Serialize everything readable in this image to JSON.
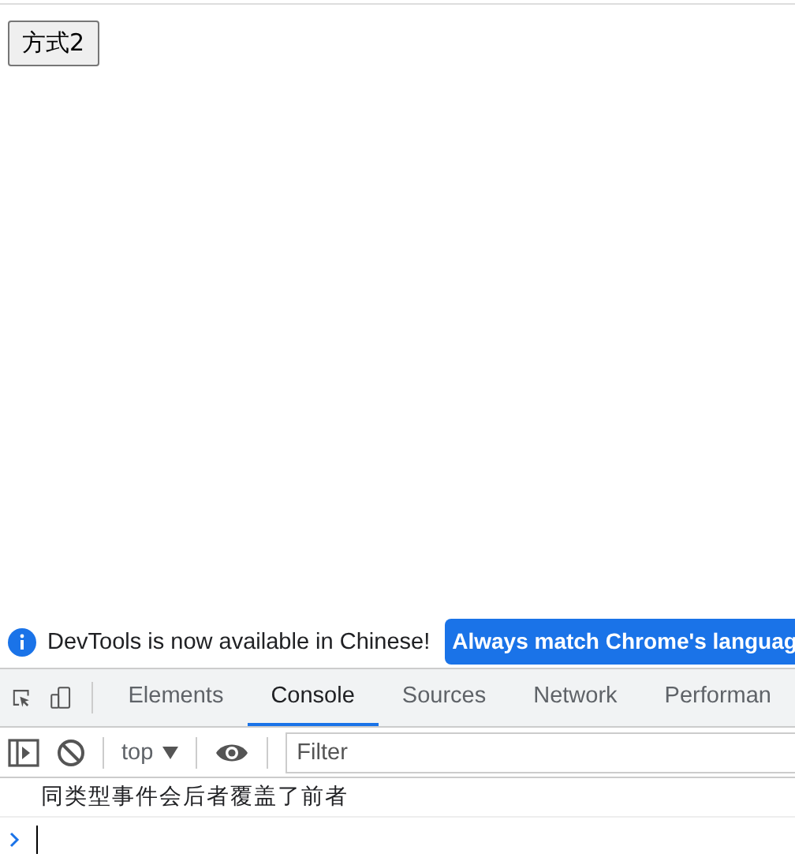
{
  "page": {
    "button": "方式2"
  },
  "devtools": {
    "infobar": {
      "message": "DevTools is now available in Chinese!",
      "action": "Always match Chrome's languag"
    },
    "tabs": [
      {
        "label": "Elements",
        "selected": false
      },
      {
        "label": "Console",
        "selected": true
      },
      {
        "label": "Sources",
        "selected": false
      },
      {
        "label": "Network",
        "selected": false
      },
      {
        "label": "Performan",
        "selected": false
      }
    ],
    "toolbar": {
      "context": "top",
      "filter_placeholder": "Filter"
    },
    "messages": [
      "同类型事件会后者覆盖了前者"
    ]
  }
}
